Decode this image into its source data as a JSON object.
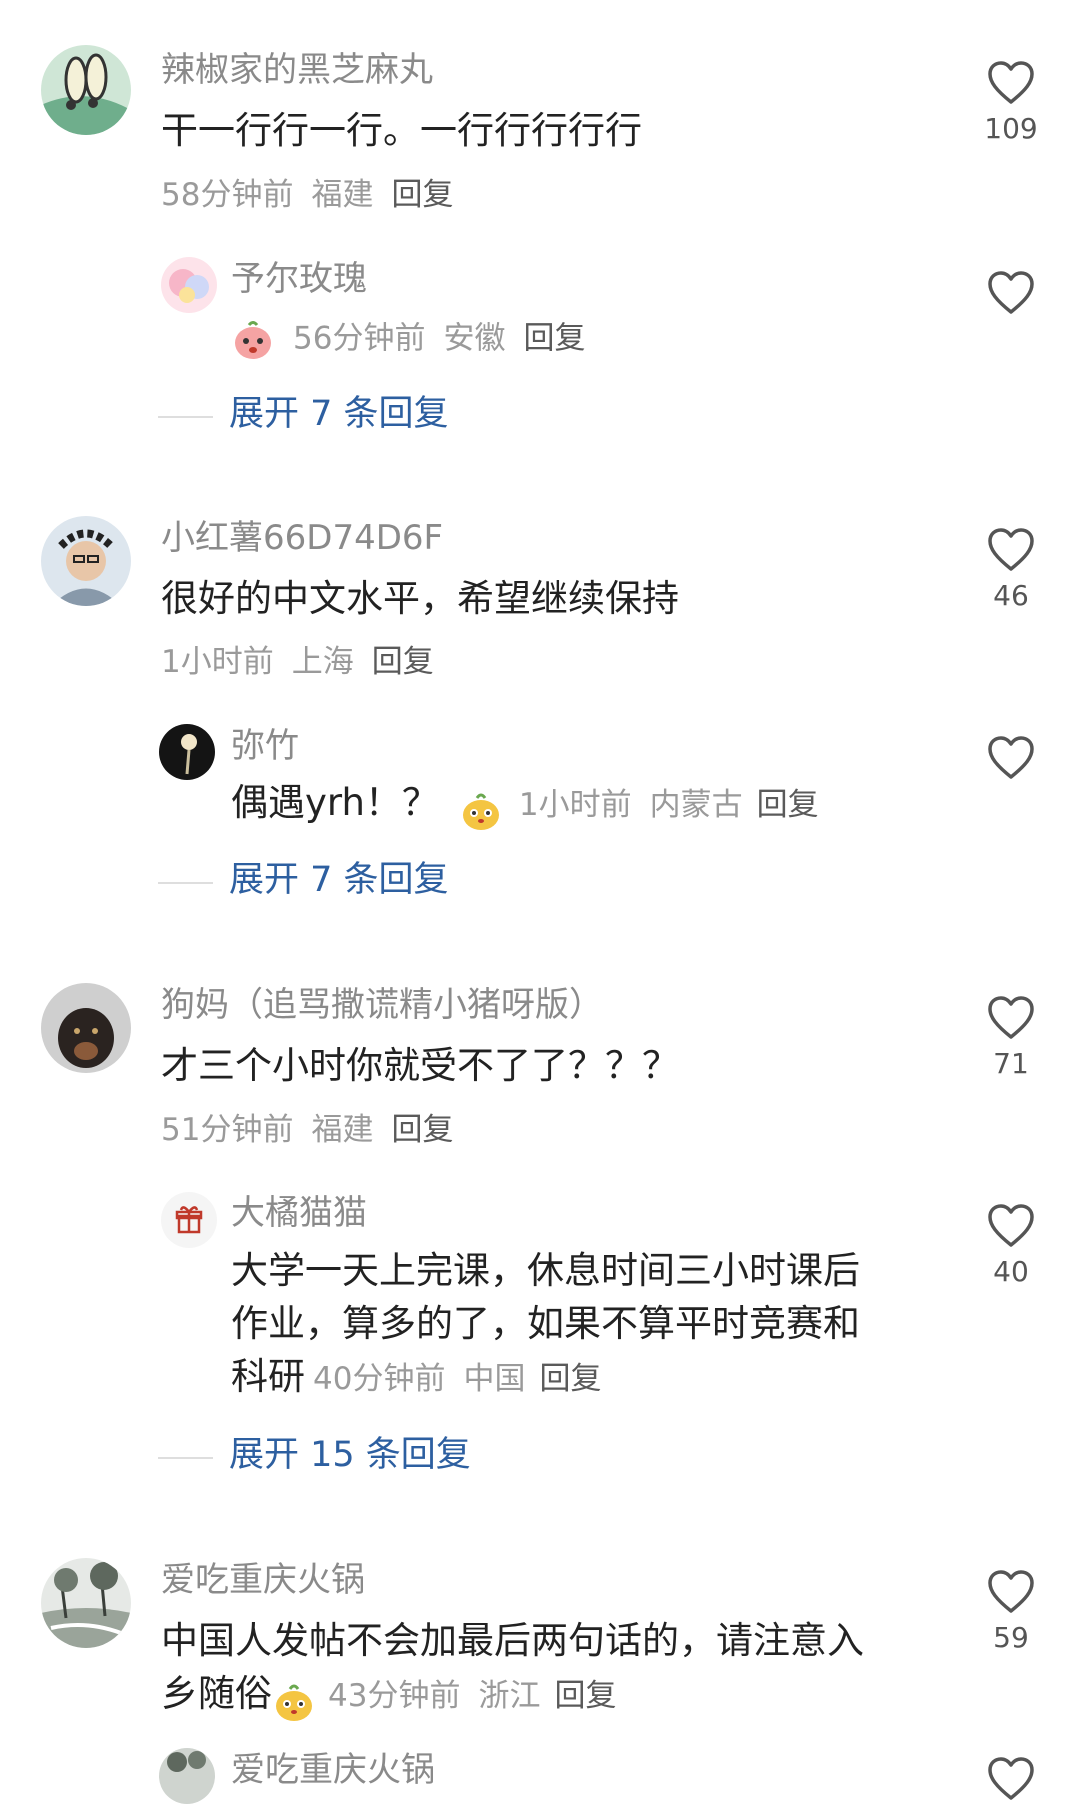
{
  "comments": [
    {
      "user": "辣椒家的黑芝麻丸",
      "text": "干一行行一行。一行行行行行",
      "time": "58分钟前",
      "location": "福建",
      "reply_label": "回复",
      "likes": "109",
      "sub": {
        "user": "予尔玫瑰",
        "time": "56分钟前",
        "location": "安徽",
        "reply_label": "回复"
      },
      "expand": "展开 7 条回复"
    },
    {
      "user": "小红薯66D74D6F",
      "text": "很好的中文水平，希望继续保持",
      "time": "1小时前",
      "location": "上海",
      "reply_label": "回复",
      "likes": "46",
      "sub": {
        "user": "弥竹",
        "text": "偶遇yrh！？",
        "time": "1小时前",
        "location": "内蒙古",
        "reply_label": "回复"
      },
      "expand": "展开 7 条回复"
    },
    {
      "user": "狗妈（追骂撒谎精小猪呀版）",
      "text": "才三个小时你就受不了了？？？",
      "time": "51分钟前",
      "location": "福建",
      "reply_label": "回复",
      "likes": "71",
      "sub": {
        "user": "大橘猫猫",
        "text_line1": "大学一天上完课，休息时间三小时课后",
        "text_line2": "作业，算多的了，如果不算平时竞赛和",
        "text_line3": "科研",
        "time": "40分钟前",
        "location": "中国",
        "reply_label": "回复",
        "likes": "40"
      },
      "expand": "展开 15 条回复"
    },
    {
      "user": "爱吃重庆火锅",
      "text_line1": "中国人发帖不会加最后两句话的，请注意入",
      "text_line2": "乡随俗",
      "time": "43分钟前",
      "location": "浙江",
      "reply_label": "回复",
      "likes": "59"
    }
  ],
  "partial_next_user": "爱吃重庆火锅",
  "icons": {
    "like": "heart-outline-icon",
    "emoji_blush": "blush-face-emoji-icon",
    "emoji_cute": "cute-face-emoji-icon",
    "gift": "gift-icon"
  },
  "colors": {
    "link": "#2d5fa0",
    "meta": "#9a9a9a",
    "username": "#8a8a8a"
  }
}
